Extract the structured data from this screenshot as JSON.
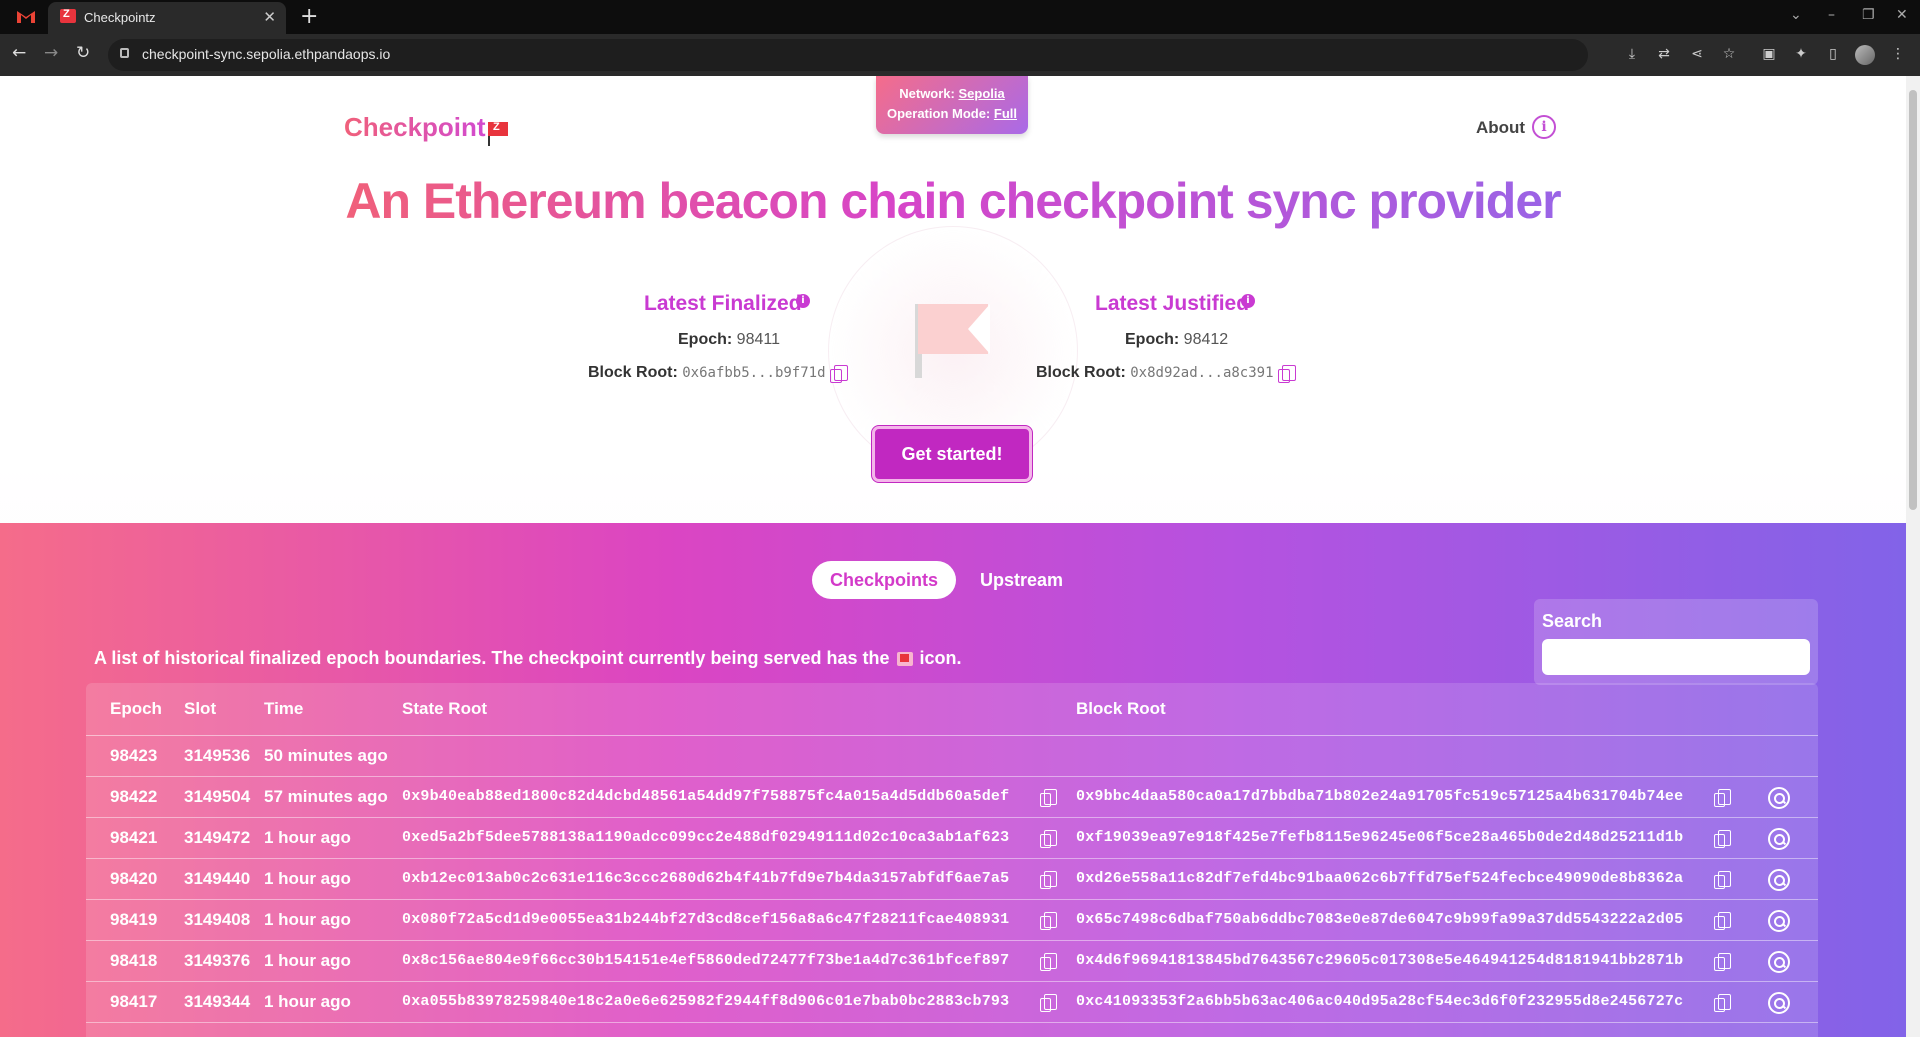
{
  "browser": {
    "tab_title": "Checkpointz",
    "tab_close": "✕",
    "new_tab": "+",
    "url": "checkpoint-sync.sepolia.ethpandaops.io",
    "back": "←",
    "forward": "→",
    "reload": "↻"
  },
  "network_badge": {
    "network_label": "Network:",
    "network_value": "Sepolia",
    "mode_label": "Operation Mode:",
    "mode_value": "Full"
  },
  "header": {
    "logo_text": "Checkpoint",
    "about_label": "About",
    "about_icon": "i"
  },
  "headline": "An Ethereum beacon chain checkpoint sync provider",
  "finalized": {
    "title": "Latest Finalized",
    "epoch_label": "Epoch:",
    "epoch_value": "98411",
    "root_label": "Block Root:",
    "root_value": "0x6afbb5...b9f71d"
  },
  "justified": {
    "title": "Latest Justified",
    "epoch_label": "Epoch:",
    "epoch_value": "98412",
    "root_label": "Block Root:",
    "root_value": "0x8d92ad...a8c391"
  },
  "get_started_label": "Get started!",
  "tabs": {
    "checkpoints": "Checkpoints",
    "upstream": "Upstream"
  },
  "search": {
    "label": "Search",
    "placeholder": ""
  },
  "description_before": "A list of historical finalized epoch boundaries. The checkpoint currently being served has the",
  "description_after": "icon.",
  "table": {
    "headers": {
      "epoch": "Epoch",
      "slot": "Slot",
      "time": "Time",
      "state_root": "State Root",
      "block_root": "Block Root"
    },
    "rows": [
      {
        "epoch": "98423",
        "slot": "3149536",
        "time": "50 minutes ago",
        "state_root": "",
        "block_root": ""
      },
      {
        "epoch": "98422",
        "slot": "3149504",
        "time": "57 minutes ago",
        "state_root": "0x9b40eab88ed1800c82d4dcbd48561a54dd97f758875fc4a015a4d5ddb60a5def",
        "block_root": "0x9bbc4daa580ca0a17d7bbdba71b802e24a91705fc519c57125a4b631704b74ee"
      },
      {
        "epoch": "98421",
        "slot": "3149472",
        "time": "1 hour ago",
        "state_root": "0xed5a2bf5dee5788138a1190adcc099cc2e488df02949111d02c10ca3ab1af623",
        "block_root": "0xf19039ea97e918f425e7fefb8115e96245e06f5ce28a465b0de2d48d25211d1b"
      },
      {
        "epoch": "98420",
        "slot": "3149440",
        "time": "1 hour ago",
        "state_root": "0xb12ec013ab0c2c631e116c3ccc2680d62b4f41b7fd9e7b4da3157abfdf6ae7a5",
        "block_root": "0xd26e558a11c82df7efd4bc91baa062c6b7ffd75ef524fecbce49090de8b8362a"
      },
      {
        "epoch": "98419",
        "slot": "3149408",
        "time": "1 hour ago",
        "state_root": "0x080f72a5cd1d9e0055ea31b244bf27d3cd8cef156a8a6c47f28211fcae408931",
        "block_root": "0x65c7498c6dbaf750ab6ddbc7083e0e87de6047c9b99fa99a37dd5543222a2d05"
      },
      {
        "epoch": "98418",
        "slot": "3149376",
        "time": "1 hour ago",
        "state_root": "0x8c156ae804e9f66cc30b154151e4ef5860ded72477f73be1a4d7c361bfcef897",
        "block_root": "0x4d6f96941813845bd7643567c29605c017308e5e464941254d8181941bb2871b"
      },
      {
        "epoch": "98417",
        "slot": "3149344",
        "time": "1 hour ago",
        "state_root": "0xa055b83978259840e18c2a0e6e625982f2944ff8d906c01e7bab0bc2883cb793",
        "block_root": "0xc41093353f2a6bb5b63ac406ac040d95a28cf54ec3d6f0f232955d8e2456727c"
      }
    ]
  },
  "colors": {
    "accent": "#c93ad2",
    "gradient_start": "#f56c8a",
    "gradient_end": "#8263e8"
  }
}
